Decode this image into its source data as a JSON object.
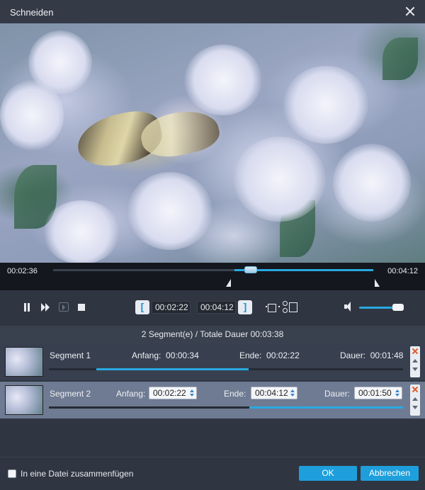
{
  "window": {
    "title": "Schneiden",
    "close_icon": "close-icon"
  },
  "timeline": {
    "current_time": "00:02:36",
    "total_time": "00:04:12",
    "progress_fraction": 0.62,
    "selection_start_fraction": 0.565,
    "selection_end_fraction": 1.0
  },
  "controls": {
    "icons": [
      "pause-icon",
      "fast-forward-icon",
      "frame-step-icon",
      "stop-icon",
      "crop-icon",
      "scissors-icon",
      "volume-icon"
    ],
    "set_start_label": "[",
    "start_time": "00:02:22",
    "end_time": "00:04:12",
    "set_end_label": "]",
    "volume_fraction": 0.9
  },
  "summary": "2 Segment(e) / Totale Dauer 00:03:38",
  "segments": [
    {
      "name": "Segment 1",
      "anfang_label": "Anfang:",
      "anfang": "00:00:34",
      "ende_label": "Ende:",
      "ende": "00:02:22",
      "dauer_label": "Dauer:",
      "dauer": "00:01:48"
    },
    {
      "name": "Segment 2",
      "anfang_label": "Anfang:",
      "anfang": "00:02:22",
      "ende_label": "Ende:",
      "ende": "00:04:12",
      "dauer_label": "Dauer:",
      "dauer": "00:01:50"
    }
  ],
  "footer": {
    "merge_label": "In eine Datei zusammenfügen",
    "merge_checked": false,
    "ok_label": "OK",
    "cancel_label": "Abbrechen"
  },
  "colors": {
    "accent": "#29a9e0",
    "button": "#1e9fdc",
    "background": "#2f3642",
    "selected_row": "#6f7b92"
  }
}
